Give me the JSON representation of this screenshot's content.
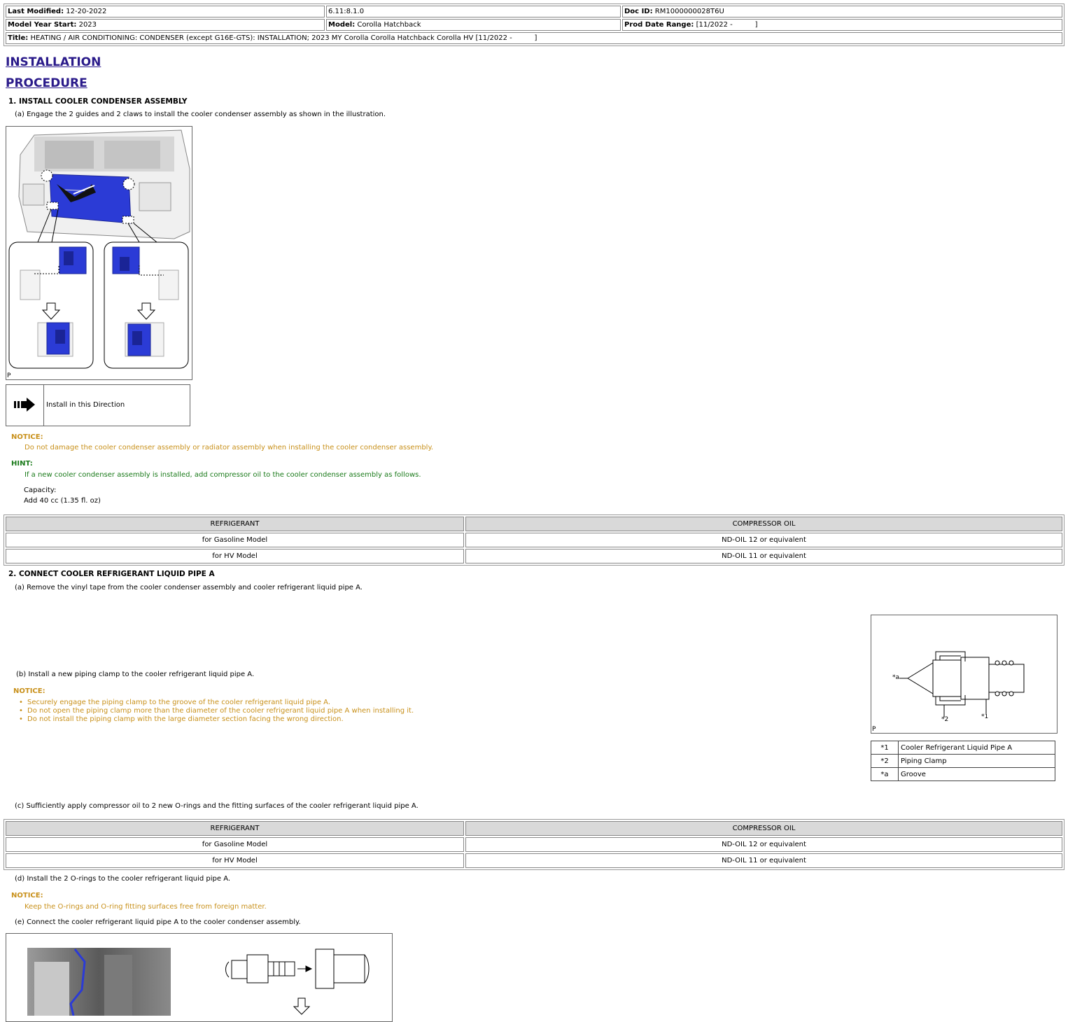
{
  "header": {
    "last_modified_label": "Last Modified:",
    "last_modified": "12-20-2022",
    "version": "6.11:8.1.0",
    "doc_id_label": "Doc ID:",
    "doc_id": "RM1000000028T6U",
    "model_year_label": "Model Year Start:",
    "model_year": "2023",
    "model_label": "Model:",
    "model": "Corolla Hatchback",
    "prod_date_label": "Prod Date Range:",
    "prod_date": "[11/2022 -          ]",
    "title_label": "Title:",
    "title": "HEATING / AIR CONDITIONING: CONDENSER (except G16E-GTS): INSTALLATION; 2023 MY Corolla Corolla Hatchback Corolla HV [11/2022 -          ]"
  },
  "headings": {
    "installation": "INSTALLATION",
    "procedure": "PROCEDURE"
  },
  "step1": {
    "title": "1. INSTALL COOLER CONDENSER ASSEMBLY",
    "a": "(a) Engage the 2 guides and 2 claws to install the cooler condenser assembly as shown in the illustration.",
    "fig_mark": "P",
    "legend_text": "Install in this Direction",
    "notice_label": "NOTICE:",
    "notice_text": "Do not damage the cooler condenser assembly or radiator assembly when installing the cooler condenser assembly.",
    "hint_label": "HINT:",
    "hint_text": "If a new cooler condenser assembly is installed, add compressor oil to the cooler condenser assembly as follows.",
    "capacity_label": "Capacity:",
    "capacity_value": "Add 40 cc (1.35 fl. oz)"
  },
  "oil_table": {
    "headers": [
      "REFRIGERANT",
      "COMPRESSOR OIL"
    ],
    "rows": [
      [
        "for Gasoline Model",
        "ND-OIL 12 or equivalent"
      ],
      [
        "for HV Model",
        "ND-OIL 11 or equivalent"
      ]
    ]
  },
  "step2": {
    "title": "2. CONNECT COOLER REFRIGERANT LIQUID PIPE A",
    "a": "(a) Remove the vinyl tape from the cooler condenser assembly and cooler refrigerant liquid pipe A.",
    "b": "(b) Install a new piping clamp to the cooler refrigerant liquid pipe A.",
    "notice_label": "NOTICE:",
    "b_notices": [
      "Securely engage the piping clamp to the groove of the cooler refrigerant liquid pipe A.",
      "Do not open the piping clamp more than the diameter of the cooler refrigerant liquid pipe A when installing it.",
      "Do not install the piping clamp with the large diameter section facing the wrong direction."
    ],
    "fig_mark": "P",
    "callouts": {
      "a": "*a",
      "one": "*1",
      "two": "*2"
    },
    "legend": [
      [
        "*1",
        "Cooler Refrigerant Liquid Pipe A"
      ],
      [
        "*2",
        "Piping Clamp"
      ],
      [
        "*a",
        "Groove"
      ]
    ],
    "c": "(c) Sufficiently apply compressor oil to 2 new O-rings and the fitting surfaces of the cooler refrigerant liquid pipe A.",
    "d": "(d) Install the 2 O-rings to the cooler refrigerant liquid pipe A.",
    "d_notice": "Keep the O-rings and O-ring fitting surfaces free from foreign matter.",
    "e": "(e) Connect the cooler refrigerant liquid pipe A to the cooler condenser assembly."
  },
  "colors": {
    "heading": "#2a1a8a",
    "notice": "#c8901a",
    "hint": "#1a7a1a",
    "part_blue": "#2b3bd6"
  }
}
